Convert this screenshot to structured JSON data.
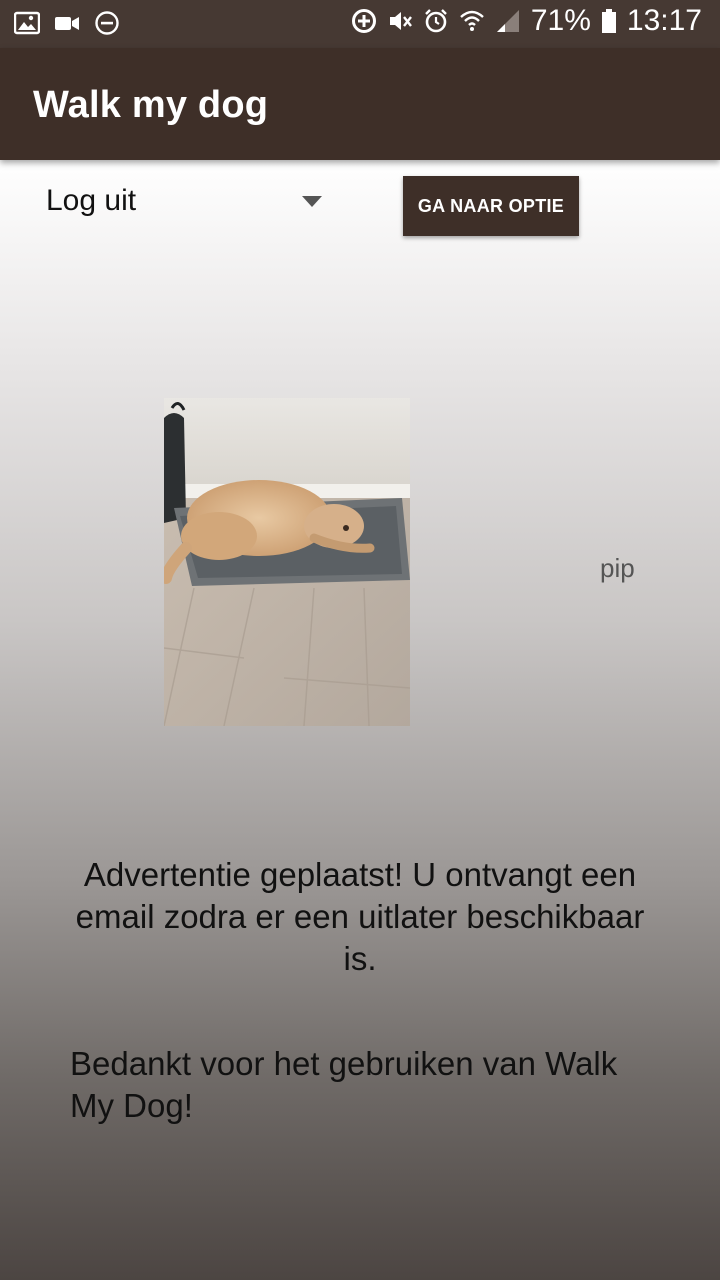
{
  "status_bar": {
    "battery_percent": "71%",
    "time": "13:17",
    "left_icons": [
      "image-icon",
      "video-camera-icon",
      "do-not-disturb-icon"
    ],
    "right_icons": [
      "data-saver-icon",
      "mute-icon",
      "alarm-icon",
      "wifi-icon",
      "signal-icon",
      "battery-icon"
    ]
  },
  "app_bar": {
    "title": "Walk my dog"
  },
  "menu": {
    "selected_option": "Log uit",
    "go_button_label": "GA NAAR OPTIE"
  },
  "dog": {
    "name": "pip",
    "photo": "dog-photo"
  },
  "confirmation": {
    "message": "Advertentie geplaatst! U ontvangt een email zodra er een uitlater beschikbaar is.",
    "thanks": "Bedankt voor het gebruiken van Walk My Dog!"
  },
  "colors": {
    "primary_dark": "#3e2f28",
    "status_bar": "#463933",
    "text": "#111111"
  }
}
